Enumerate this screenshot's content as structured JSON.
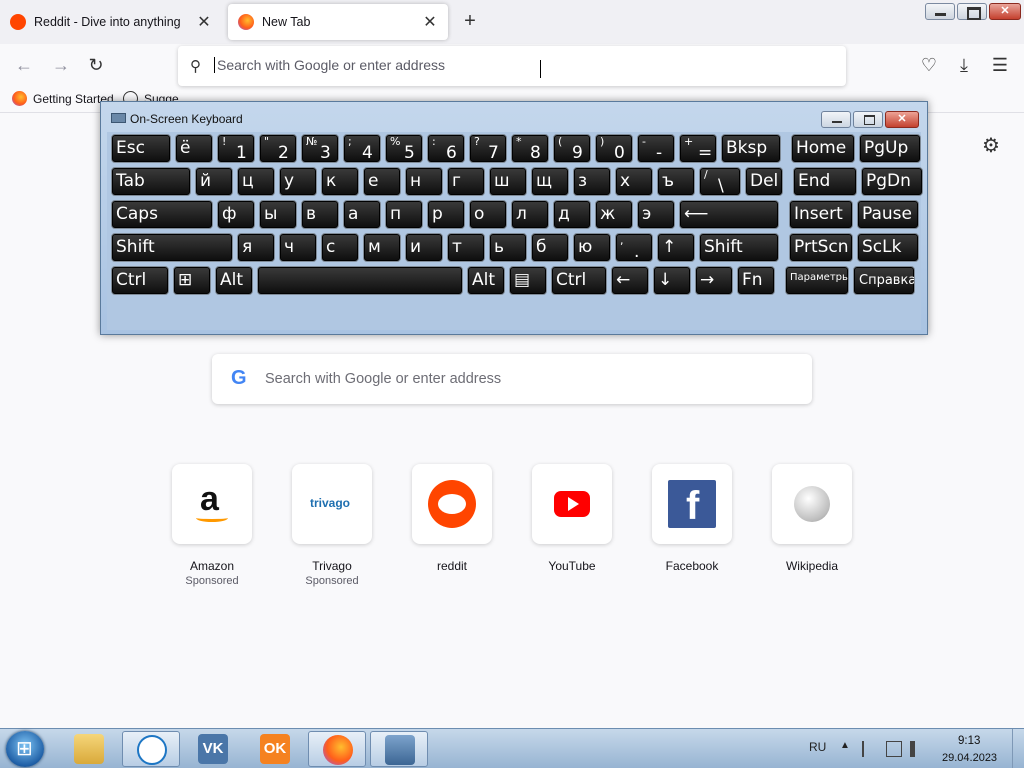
{
  "tabs": [
    {
      "label": "Reddit - Dive into anything",
      "close": "✕"
    },
    {
      "label": "New Tab",
      "close": "✕"
    }
  ],
  "new_tab": "+",
  "window_close": "✕",
  "nav": {
    "back_icon": "←",
    "forward_icon": "→",
    "reload_icon": "↻",
    "search_icon": "⚲",
    "urlbar_placeholder": "Search with Google or enter address",
    "pocket_icon": "♡",
    "download_icon": "⤓",
    "menu_icon": "☰"
  },
  "bookmarks": [
    {
      "label": "Getting Started",
      "icon": "firefox-icon"
    },
    {
      "label": "Sugge",
      "icon": "globe-icon"
    }
  ],
  "settings_icon": "⚙",
  "osk": {
    "title": "On-Screen Keyboard",
    "close": "✕",
    "rows": [
      [
        {
          "main": "Esc"
        },
        {
          "main": "ё"
        },
        {
          "shift": "!",
          "low": "1"
        },
        {
          "shift": "\"",
          "low": "2"
        },
        {
          "shift": "№",
          "low": "3"
        },
        {
          "shift": ";",
          "low": "4"
        },
        {
          "shift": "%",
          "low": "5"
        },
        {
          "shift": ":",
          "low": "6"
        },
        {
          "shift": "?",
          "low": "7"
        },
        {
          "shift": "*",
          "low": "8"
        },
        {
          "shift": "(",
          "low": "9"
        },
        {
          "shift": ")",
          "low": "0"
        },
        {
          "shift": "-",
          "low": "-"
        },
        {
          "shift": "+",
          "low": "="
        },
        {
          "main": "Bksp"
        },
        {
          "main": "Home"
        },
        {
          "main": "PgUp"
        }
      ],
      [
        {
          "main": "Tab"
        },
        {
          "main": "й"
        },
        {
          "main": "ц"
        },
        {
          "main": "у"
        },
        {
          "main": "к"
        },
        {
          "main": "е"
        },
        {
          "main": "н"
        },
        {
          "main": "г"
        },
        {
          "main": "ш"
        },
        {
          "main": "щ"
        },
        {
          "main": "з"
        },
        {
          "main": "х"
        },
        {
          "main": "ъ"
        },
        {
          "shift": "/",
          "low": "\\"
        },
        {
          "main": "Del"
        },
        {
          "main": "End"
        },
        {
          "main": "PgDn"
        }
      ],
      [
        {
          "main": "Caps"
        },
        {
          "main": "ф"
        },
        {
          "main": "ы"
        },
        {
          "main": "в"
        },
        {
          "main": "а"
        },
        {
          "main": "п"
        },
        {
          "main": "р"
        },
        {
          "main": "о"
        },
        {
          "main": "л"
        },
        {
          "main": "д"
        },
        {
          "main": "ж"
        },
        {
          "main": "э"
        },
        {
          "main": "⟵"
        },
        {
          "main": "Insert"
        },
        {
          "main": "Pause"
        }
      ],
      [
        {
          "main": "Shift"
        },
        {
          "main": "я"
        },
        {
          "main": "ч"
        },
        {
          "main": "с"
        },
        {
          "main": "м"
        },
        {
          "main": "и"
        },
        {
          "main": "т"
        },
        {
          "main": "ь"
        },
        {
          "main": "б"
        },
        {
          "main": "ю"
        },
        {
          "shift": ",",
          "low": "."
        },
        {
          "main": "↑"
        },
        {
          "main": "Shift"
        },
        {
          "main": "PrtScn"
        },
        {
          "main": "ScLk"
        }
      ],
      [
        {
          "main": "Ctrl"
        },
        {
          "main": "⊞"
        },
        {
          "main": "Alt"
        },
        {
          "main": ""
        },
        {
          "main": "Alt"
        },
        {
          "main": "▤"
        },
        {
          "main": "Ctrl"
        },
        {
          "main": "←"
        },
        {
          "main": "↓"
        },
        {
          "main": "→"
        },
        {
          "main": "Fn"
        },
        {
          "small": "Параметры"
        },
        {
          "btm": "Справка"
        }
      ]
    ]
  },
  "google_search": {
    "icon": "G",
    "placeholder": "Search with Google or enter address"
  },
  "top_sites": [
    {
      "name": "Amazon",
      "sponsor": "Sponsored",
      "icon": "a",
      "color": "#111111"
    },
    {
      "name": "Trivago",
      "sponsor": "Sponsored",
      "icon": "trivago",
      "color": "#e3811f"
    },
    {
      "name": "reddit",
      "icon": "reddit-icon",
      "color": "#ff4500"
    },
    {
      "name": "YouTube",
      "icon": "youtube-icon",
      "color": "#ff0000"
    },
    {
      "name": "Facebook",
      "icon": "f",
      "color": "#1877f2"
    },
    {
      "name": "Wikipedia",
      "icon": "wikipedia-icon",
      "color": "#888888"
    }
  ],
  "taskbar": {
    "apps": [
      "explorer-icon",
      "app-icon",
      "vk-icon",
      "ok-icon",
      "firefox-icon",
      "keyboard-icon"
    ],
    "vk_label": "VK",
    "ok_label": "OK",
    "lang": "RU",
    "up_icon": "▲",
    "time": "9:13",
    "date": "29.04.2023"
  }
}
